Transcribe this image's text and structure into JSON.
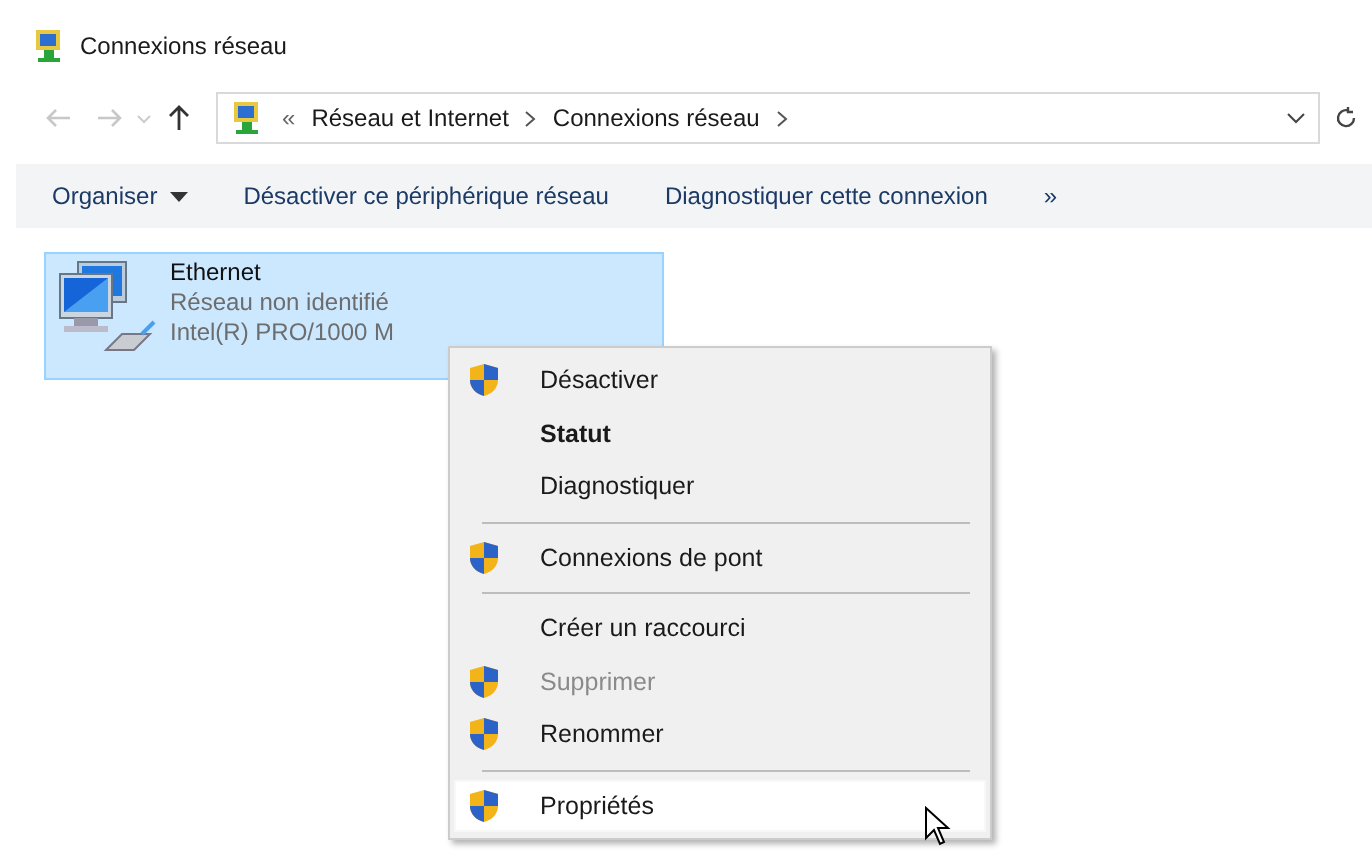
{
  "window": {
    "title": "Connexions réseau"
  },
  "address_bar": {
    "overflow": "«",
    "path": [
      {
        "label": "Réseau et Internet"
      },
      {
        "label": "Connexions réseau"
      }
    ]
  },
  "toolbar": {
    "items": [
      {
        "label": "Organiser",
        "dropdown": true
      },
      {
        "label": "Désactiver ce périphérique réseau",
        "dropdown": false
      },
      {
        "label": "Diagnostiquer cette connexion",
        "dropdown": false
      }
    ],
    "more": "»"
  },
  "connections": [
    {
      "name": "Ethernet",
      "status": "Réseau non identifié",
      "device": "Intel(R) PRO/1000 M",
      "selected": true
    }
  ],
  "context_menu": {
    "items": [
      {
        "kind": "item",
        "label": "Désactiver",
        "shield": true,
        "bold": false,
        "disabled": false,
        "selected": false
      },
      {
        "kind": "item",
        "label": "Statut",
        "shield": false,
        "bold": true,
        "disabled": false,
        "selected": false
      },
      {
        "kind": "item",
        "label": "Diagnostiquer",
        "shield": false,
        "bold": false,
        "disabled": false,
        "selected": false
      },
      {
        "kind": "separator"
      },
      {
        "kind": "item",
        "label": "Connexions de pont",
        "shield": true,
        "bold": false,
        "disabled": false,
        "selected": false
      },
      {
        "kind": "separator"
      },
      {
        "kind": "item",
        "label": "Créer un raccourci",
        "shield": false,
        "bold": false,
        "disabled": false,
        "selected": false
      },
      {
        "kind": "item",
        "label": "Supprimer",
        "shield": true,
        "bold": false,
        "disabled": true,
        "selected": false
      },
      {
        "kind": "item",
        "label": "Renommer",
        "shield": true,
        "bold": false,
        "disabled": false,
        "selected": false
      },
      {
        "kind": "separator"
      },
      {
        "kind": "item",
        "label": "Propriétés",
        "shield": true,
        "bold": false,
        "disabled": false,
        "selected": true
      }
    ]
  }
}
